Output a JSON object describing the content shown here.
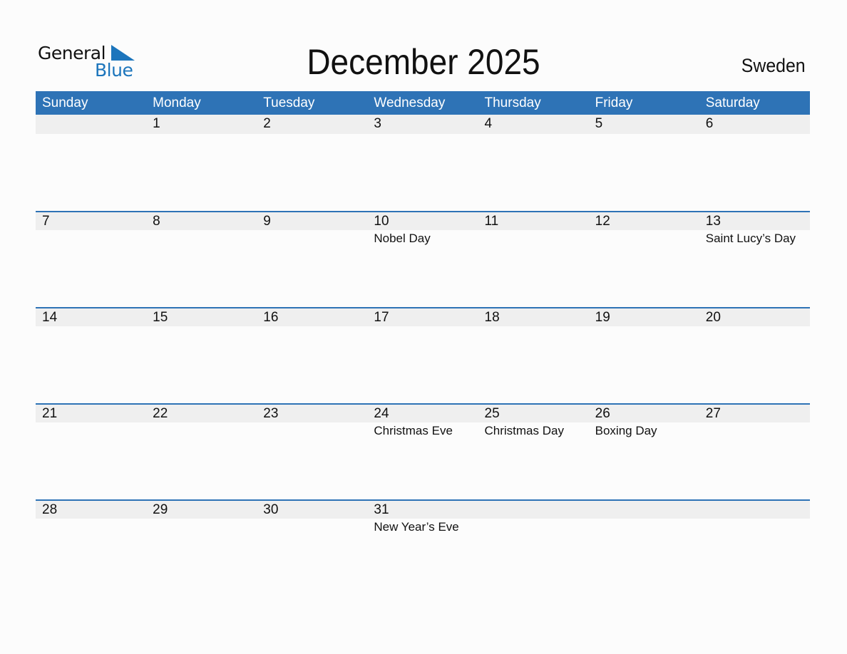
{
  "logo": {
    "line1": "General",
    "line2": "Blue",
    "icon": "triangle-icon"
  },
  "title": "December 2025",
  "country": "Sweden",
  "colors": {
    "accent": "#2e73b6",
    "logo_blue": "#1c75bc",
    "day_row_bg": "#efefef"
  },
  "weekdays": [
    "Sunday",
    "Monday",
    "Tuesday",
    "Wednesday",
    "Thursday",
    "Friday",
    "Saturday"
  ],
  "weeks": [
    {
      "days": [
        "",
        "1",
        "2",
        "3",
        "4",
        "5",
        "6"
      ],
      "holidays": [
        "",
        "",
        "",
        "",
        "",
        "",
        ""
      ]
    },
    {
      "days": [
        "7",
        "8",
        "9",
        "10",
        "11",
        "12",
        "13"
      ],
      "holidays": [
        "",
        "",
        "",
        "Nobel Day",
        "",
        "",
        "Saint Lucy’s Day"
      ]
    },
    {
      "days": [
        "14",
        "15",
        "16",
        "17",
        "18",
        "19",
        "20"
      ],
      "holidays": [
        "",
        "",
        "",
        "",
        "",
        "",
        ""
      ]
    },
    {
      "days": [
        "21",
        "22",
        "23",
        "24",
        "25",
        "26",
        "27"
      ],
      "holidays": [
        "",
        "",
        "",
        "Christmas Eve",
        "Christmas Day",
        "Boxing Day",
        ""
      ]
    },
    {
      "days": [
        "28",
        "29",
        "30",
        "31",
        "",
        "",
        ""
      ],
      "holidays": [
        "",
        "",
        "",
        "New Year’s Eve",
        "",
        "",
        ""
      ]
    }
  ]
}
